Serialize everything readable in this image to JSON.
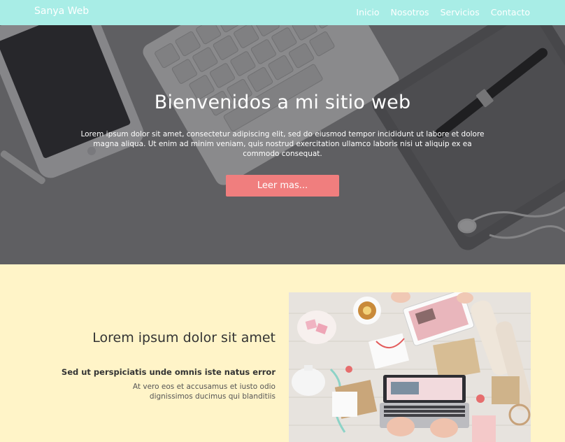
{
  "navbar": {
    "brand": "Sanya Web",
    "links": [
      "Inicio",
      "Nosotros",
      "Servicios",
      "Contacto"
    ]
  },
  "hero": {
    "title": "Bienvenidos a mi sitio web",
    "text": "Lorem ipsum dolor sit amet, consectetur adipiscing elit, sed do eiusmod tempor incididunt ut labore et dolore magna aliqua. Ut enim ad minim veniam, quis nostrud exercitation ullamco laboris nisi ut aliquip ex ea commodo consequat.",
    "button_label": "Leer mas..."
  },
  "feature": {
    "title": "Lorem ipsum dolor sit amet",
    "subtitle": "Sed ut perspiciatis unde omnis iste natus error",
    "text": "At vero eos et accusamus et iusto odio dignissimos ducimus qui blanditiis"
  },
  "colors": {
    "navbar_bg": "#a8ede6",
    "button_bg": "#f07e7e",
    "feature_bg": "#fff4c8"
  }
}
